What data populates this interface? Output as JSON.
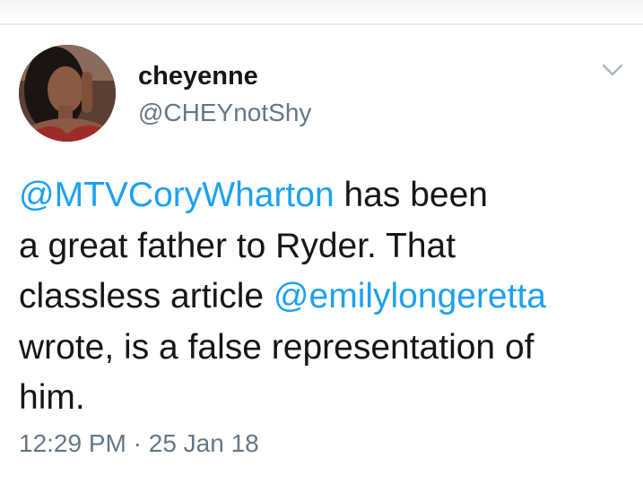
{
  "user": {
    "display_name": "cheyenne",
    "handle": "@CHEYnotShy"
  },
  "tweet": {
    "mention_1": "@MTVCoryWharton",
    "text_1": " has been",
    "text_2": "a great father to Ryder. That",
    "text_3": "classless article ",
    "mention_2": "@emilylongeretta",
    "text_4": "wrote, is a false representation of",
    "text_5": "him."
  },
  "meta": {
    "time": "12:29 PM",
    "separator": " · ",
    "date": "25 Jan 18"
  },
  "icons": {
    "menu": "chevron-down-icon"
  },
  "colors": {
    "mention": "#1da1f2",
    "text": "#14171a",
    "secondary": "#657786"
  }
}
